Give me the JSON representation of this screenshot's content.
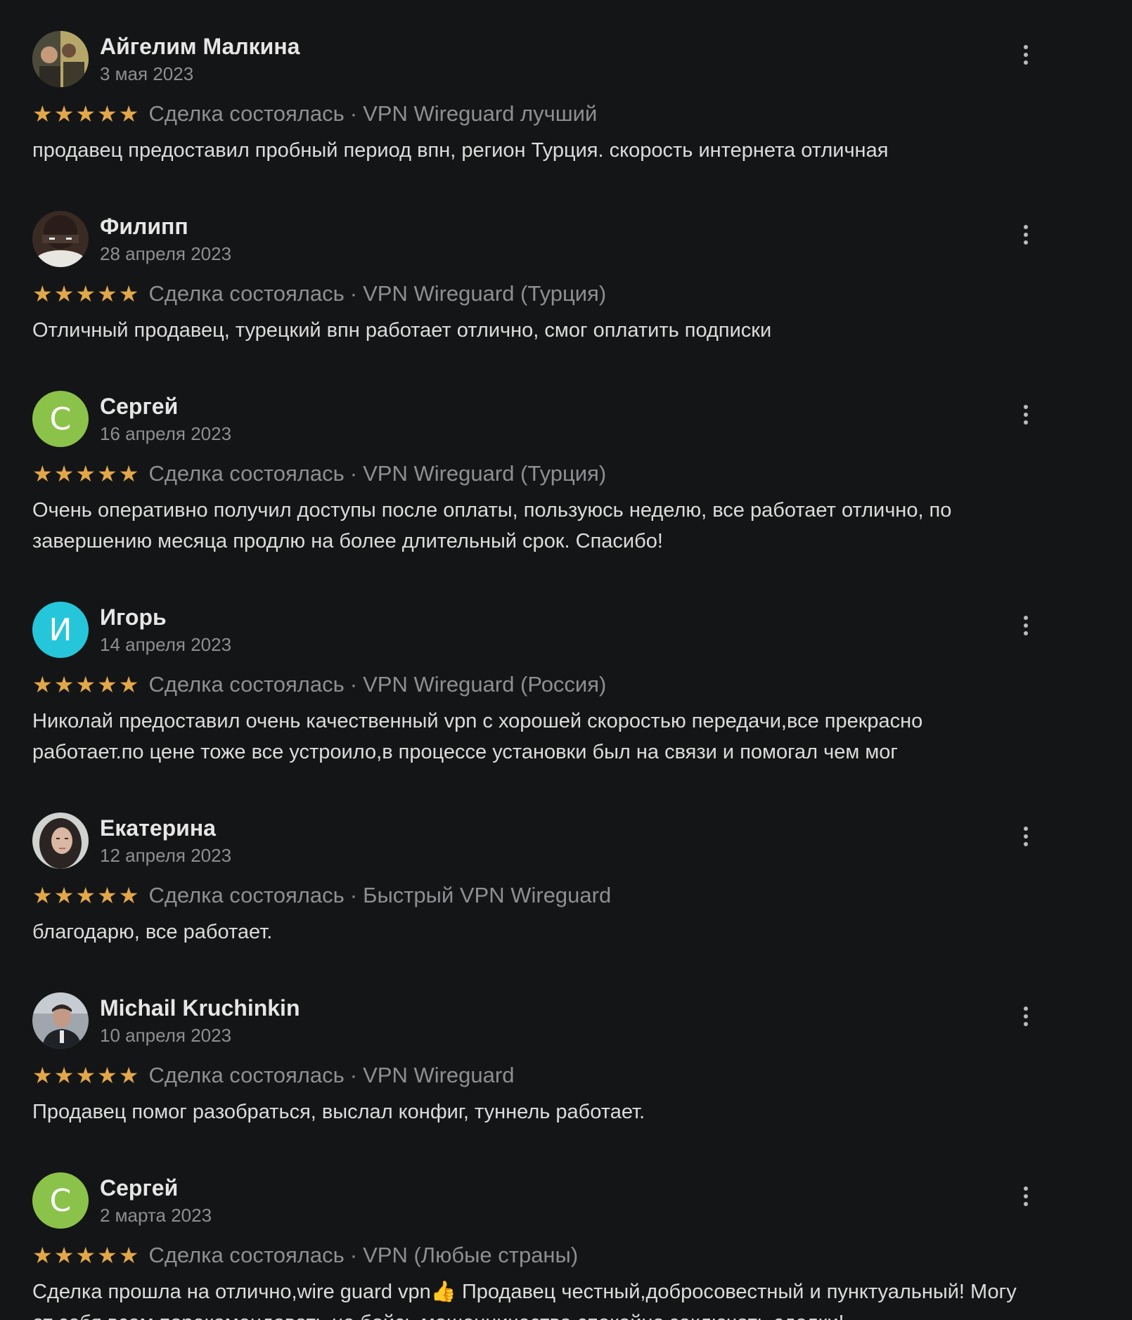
{
  "reviews": [
    {
      "name": "Айгелим Малкина",
      "date": "3 мая 2023",
      "status": "Сделка состоялась",
      "product": "VPN Wireguard лучший",
      "text": "продавец предоставил пробный период впн, регион Турция. скорость интернета отличная",
      "rating": 5,
      "avatar": {
        "type": "photo"
      }
    },
    {
      "name": "Филипп",
      "date": "28 апреля 2023",
      "status": "Сделка состоялась",
      "product": "VPN Wireguard (Турция)",
      "text": "Отличный продавец, турецкий впн работает отлично, смог оплатить подписки",
      "rating": 5,
      "avatar": {
        "type": "photo"
      }
    },
    {
      "name": "Сергей",
      "date": "16 апреля 2023",
      "status": "Сделка состоялась",
      "product": "VPN Wireguard (Турция)",
      "text": "Очень оперативно получил доступы после оплаты, пользуюсь неделю, все работает отлично, по завершению месяца продлю на более длительный срок. Спасибо!",
      "rating": 5,
      "avatar": {
        "type": "letter",
        "letter": "С",
        "color": "#8bc34a"
      }
    },
    {
      "name": "Игорь",
      "date": "14 апреля 2023",
      "status": "Сделка состоялась",
      "product": "VPN Wireguard (Россия)",
      "text": "Николай предоставил очень качественный vpn с хорошей скоростью передачи,все прекрасно работает.по цене тоже все устроило,в процессе установки был на связи и помогал чем мог",
      "rating": 5,
      "avatar": {
        "type": "letter",
        "letter": "И",
        "color": "#26c6da"
      }
    },
    {
      "name": "Екатерина",
      "date": "12 апреля 2023",
      "status": "Сделка состоялась",
      "product": "Быстрый VPN Wireguard",
      "text": "благодарю, все работает.",
      "rating": 5,
      "avatar": {
        "type": "photo"
      }
    },
    {
      "name": "Michail Kruchinkin",
      "date": "10 апреля 2023",
      "status": "Сделка состоялась",
      "product": "VPN Wireguard",
      "text": "Продавец помог разобраться, выслал конфиг, туннель работает.",
      "rating": 5,
      "avatar": {
        "type": "photo"
      }
    },
    {
      "name": "Сергей",
      "date": "2 марта 2023",
      "status": "Сделка состоялась",
      "product": "VPN (Любые страны)",
      "text": "Сделка прошла на отлично,wire guard vpn👍 Продавец честный,добросовестный и пунктуальный! Могу от себя всем порекомендовать,не бойсь мошенничества спокойно заключать сделки!",
      "rating": 5,
      "avatar": {
        "type": "letter",
        "letter": "С",
        "color": "#8bc34a"
      }
    }
  ],
  "separator": "·",
  "colors": {
    "background": "#141516",
    "star": "#e2a74a",
    "muted": "#8d8f92",
    "text": "#dcdcdc"
  }
}
